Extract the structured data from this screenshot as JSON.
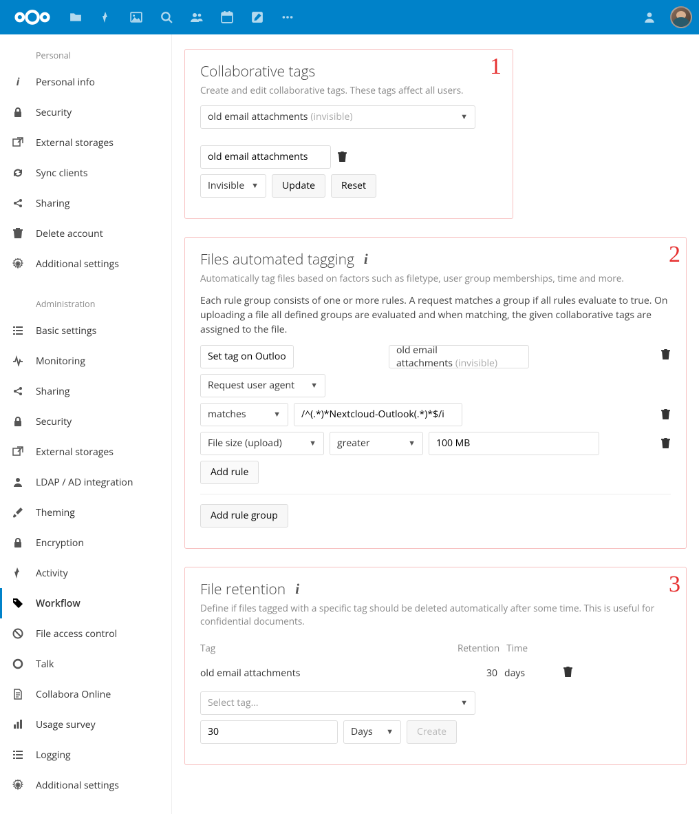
{
  "header": {
    "icons": [
      "files",
      "activity",
      "gallery",
      "search",
      "contacts",
      "calendar",
      "notes",
      "more"
    ]
  },
  "sidebar": {
    "sections": {
      "personal": "Personal",
      "admin": "Administration"
    },
    "personal_items": [
      {
        "icon": "info",
        "label": "Personal info"
      },
      {
        "icon": "lock",
        "label": "Security"
      },
      {
        "icon": "external",
        "label": "External storages"
      },
      {
        "icon": "sync",
        "label": "Sync clients"
      },
      {
        "icon": "share",
        "label": "Sharing"
      },
      {
        "icon": "trash",
        "label": "Delete account"
      },
      {
        "icon": "gear",
        "label": "Additional settings"
      }
    ],
    "admin_items": [
      {
        "icon": "list",
        "label": "Basic settings"
      },
      {
        "icon": "pulse",
        "label": "Monitoring"
      },
      {
        "icon": "share",
        "label": "Sharing"
      },
      {
        "icon": "lock",
        "label": "Security"
      },
      {
        "icon": "external",
        "label": "External storages"
      },
      {
        "icon": "user",
        "label": "LDAP / AD integration"
      },
      {
        "icon": "brush",
        "label": "Theming"
      },
      {
        "icon": "lock",
        "label": "Encryption"
      },
      {
        "icon": "bolt",
        "label": "Activity"
      },
      {
        "icon": "tag",
        "label": "Workflow"
      },
      {
        "icon": "ban",
        "label": "File access control"
      },
      {
        "icon": "talk",
        "label": "Talk"
      },
      {
        "icon": "doc",
        "label": "Collabora Online"
      },
      {
        "icon": "chart",
        "label": "Usage survey"
      },
      {
        "icon": "list",
        "label": "Logging"
      },
      {
        "icon": "gear",
        "label": "Additional settings"
      }
    ],
    "active": "Workflow"
  },
  "collab": {
    "num": "1",
    "title": "Collaborative tags",
    "sub": "Create and edit collaborative tags. These tags affect all users.",
    "sel_tag": "old email attachments",
    "sel_vis": "(invisible)",
    "edit_tag": "old email attachments",
    "vis": "Invisible",
    "update": "Update",
    "reset": "Reset"
  },
  "auto": {
    "num": "2",
    "title": "Files automated tagging",
    "sub": "Automatically tag files based on factors such as filetype, user group memberships, time and more.",
    "body": "Each rule group consists of one or more rules. A request matches a group if all rules evaluate to true. On uploading a file all defined groups are evaluated and when matching, the given collaborative tags are assigned to the file.",
    "group_name": "Set tag on Outlook",
    "group_tag": "old email attachments",
    "group_tag_vis": "(invisible)",
    "rule_agent": "Request user agent",
    "r1_op": "matches",
    "r1_val": "/^(.*)*Nextcloud-Outlook(.*)*$/i",
    "r2_field": "File size (upload)",
    "r2_op": "greater",
    "r2_val": "100 MB",
    "add_rule": "Add rule",
    "add_group": "Add rule group"
  },
  "ret": {
    "num": "3",
    "title": "File retention",
    "sub": "Define if files tagged with a specific tag should be deleted automatically after some time. This is useful for confidential documents.",
    "h_tag": "Tag",
    "h_ret": "Retention",
    "h_time": "Time",
    "row_tag": "old email attachments",
    "row_ret": "30",
    "row_time": "days",
    "sel_placeholder": "Select tag…",
    "in_ret": "30",
    "in_unit": "Days",
    "create": "Create"
  }
}
